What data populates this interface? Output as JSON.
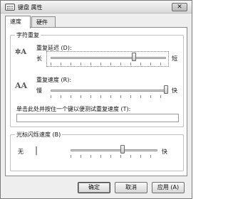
{
  "window": {
    "title": "键盘 属性",
    "close_label": "✕"
  },
  "tabs": [
    {
      "label": "速度"
    },
    {
      "label": "硬件"
    }
  ],
  "char_repeat": {
    "group_title": "字符重复",
    "delay": {
      "label": "重复延迟 (D):",
      "left": "长",
      "right": "短",
      "value": 0.72
    },
    "rate": {
      "label": "重复速度 (R):",
      "left": "慢",
      "right": "快",
      "value": 1.0
    },
    "test": {
      "label": "单击此处并按住一个键以便测试重复速度 (T):",
      "value": ""
    }
  },
  "cursor": {
    "group_title": "光标闪烁速度 (B)",
    "left": "无",
    "right": "快",
    "value": 0.6
  },
  "buttons": {
    "ok": "确定",
    "cancel": "取消",
    "apply": "应用 (A)"
  }
}
